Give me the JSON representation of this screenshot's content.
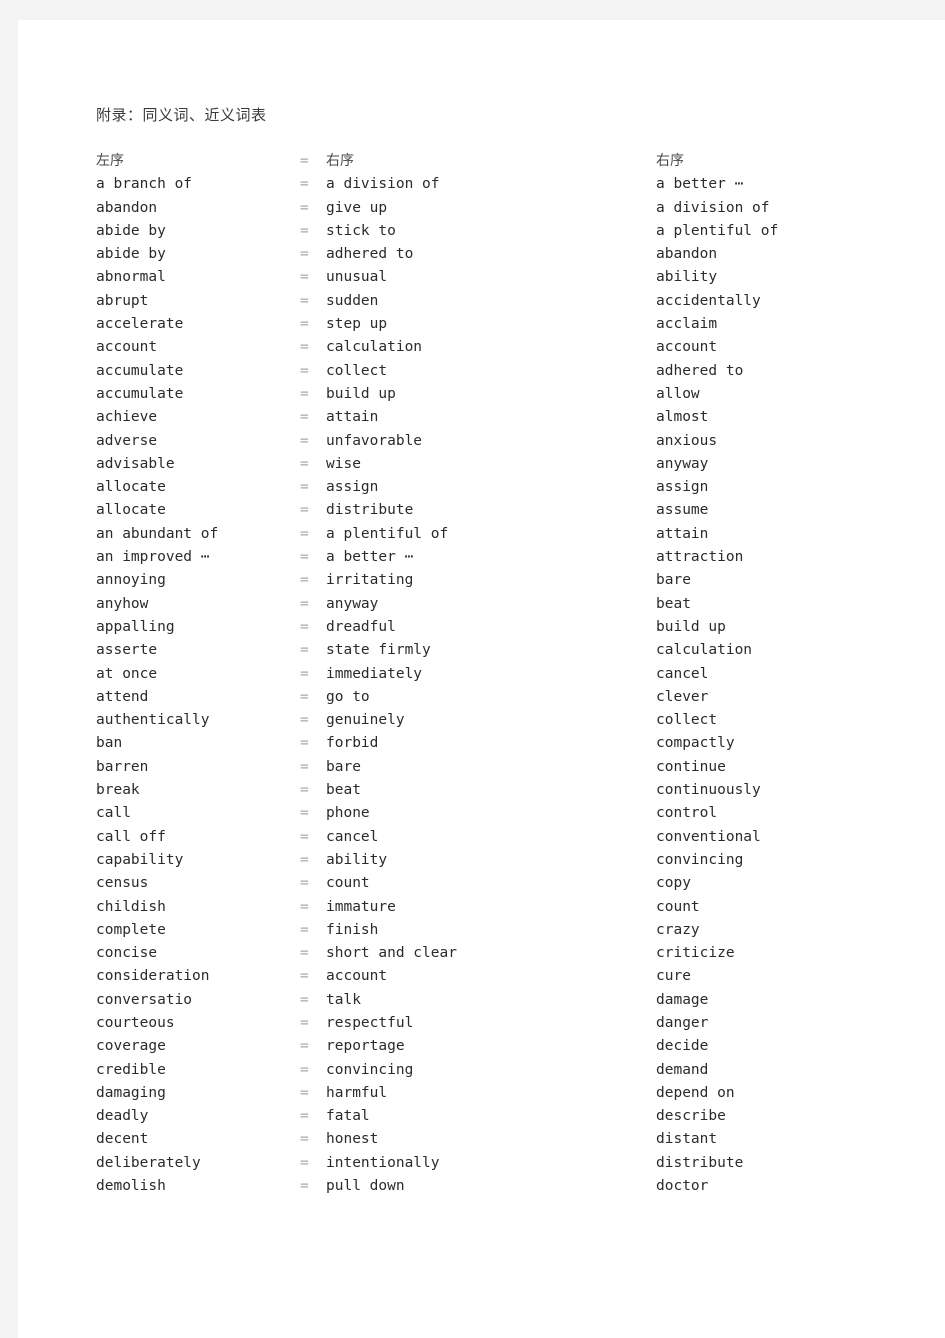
{
  "document": {
    "title": "附录：同义词、近义词表",
    "equals_sign": "=",
    "headers": {
      "left": "左序",
      "middle": "右序",
      "right": "右序"
    }
  },
  "colors": {
    "page_background": "#ffffff",
    "canvas_background": "#f3f3f3",
    "text": "#2b2b2b",
    "equals": "#a9a9a9",
    "title": "#3a3a3a"
  },
  "pairs": [
    {
      "left": "a branch of",
      "middle": "a division of"
    },
    {
      "left": "abandon",
      "middle": "give up"
    },
    {
      "left": "abide by",
      "middle": "stick to"
    },
    {
      "left": "abide by",
      "middle": "adhered to"
    },
    {
      "left": "abnormal",
      "middle": "unusual"
    },
    {
      "left": "abrupt",
      "middle": "sudden"
    },
    {
      "left": "accelerate",
      "middle": "step up"
    },
    {
      "left": "account",
      "middle": "calculation"
    },
    {
      "left": "accumulate",
      "middle": "collect"
    },
    {
      "left": "accumulate",
      "middle": "build up"
    },
    {
      "left": "achieve",
      "middle": "attain"
    },
    {
      "left": "adverse",
      "middle": "unfavorable"
    },
    {
      "left": "advisable",
      "middle": "wise"
    },
    {
      "left": "allocate",
      "middle": "assign"
    },
    {
      "left": "allocate",
      "middle": "distribute"
    },
    {
      "left": "an abundant of",
      "middle": "a plentiful of"
    },
    {
      "left": "an improved ⋯",
      "middle": "a better ⋯"
    },
    {
      "left": "annoying",
      "middle": "irritating"
    },
    {
      "left": "anyhow",
      "middle": "anyway"
    },
    {
      "left": "appalling",
      "middle": "dreadful"
    },
    {
      "left": "asserte",
      "middle": "state firmly"
    },
    {
      "left": "at once",
      "middle": "immediately"
    },
    {
      "left": "attend",
      "middle": "go to"
    },
    {
      "left": "authentically",
      "middle": "genuinely"
    },
    {
      "left": "ban",
      "middle": "forbid"
    },
    {
      "left": "barren",
      "middle": "bare"
    },
    {
      "left": "break",
      "middle": "beat"
    },
    {
      "left": "call",
      "middle": "phone"
    },
    {
      "left": "call off",
      "middle": "cancel"
    },
    {
      "left": "capability",
      "middle": "ability"
    },
    {
      "left": "census",
      "middle": "count"
    },
    {
      "left": "childish",
      "middle": "immature"
    },
    {
      "left": "complete",
      "middle": "finish"
    },
    {
      "left": "concise",
      "middle": "short and clear"
    },
    {
      "left": "consideration",
      "middle": "account"
    },
    {
      "left": "conversatio",
      "middle": "talk"
    },
    {
      "left": "courteous",
      "middle": "respectful"
    },
    {
      "left": "coverage",
      "middle": "reportage"
    },
    {
      "left": "credible",
      "middle": "convincing"
    },
    {
      "left": "damaging",
      "middle": "harmful"
    },
    {
      "left": "deadly",
      "middle": "fatal"
    },
    {
      "left": "decent",
      "middle": "honest"
    },
    {
      "left": "deliberately",
      "middle": "intentionally"
    },
    {
      "left": "demolish",
      "middle": "pull down"
    }
  ],
  "right_column": [
    "a better ⋯",
    "a division of",
    "a plentiful of",
    "abandon",
    "ability",
    "accidentally",
    "acclaim",
    "account",
    "adhered to",
    "allow",
    "almost",
    "anxious",
    "anyway",
    "assign",
    "assume",
    "attain",
    "attraction",
    "bare",
    "beat",
    "build up",
    "calculation",
    "cancel",
    "clever",
    "collect",
    "compactly",
    "continue",
    "continuously",
    "control",
    "conventional",
    "convincing",
    "copy",
    "count",
    "crazy",
    "criticize",
    "cure",
    "damage",
    "danger",
    "decide",
    "demand",
    "depend on",
    "describe",
    "distant",
    "distribute",
    "doctor"
  ]
}
